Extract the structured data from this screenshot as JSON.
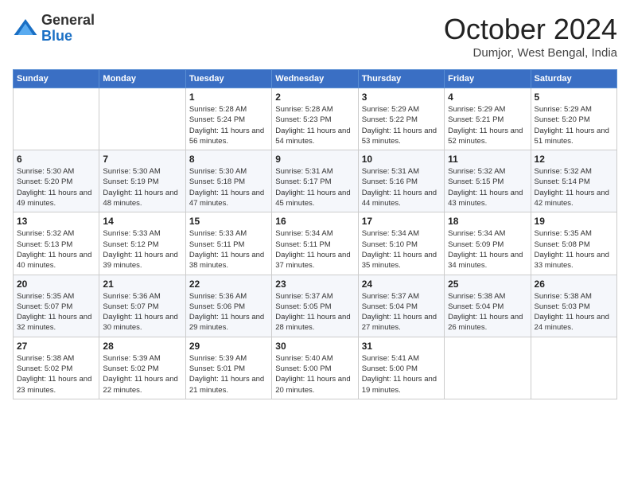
{
  "header": {
    "logo_general": "General",
    "logo_blue": "Blue",
    "month": "October 2024",
    "location": "Dumjor, West Bengal, India"
  },
  "days_of_week": [
    "Sunday",
    "Monday",
    "Tuesday",
    "Wednesday",
    "Thursday",
    "Friday",
    "Saturday"
  ],
  "weeks": [
    [
      {
        "day": "",
        "info": ""
      },
      {
        "day": "",
        "info": ""
      },
      {
        "day": "1",
        "info": "Sunrise: 5:28 AM\nSunset: 5:24 PM\nDaylight: 11 hours and 56 minutes."
      },
      {
        "day": "2",
        "info": "Sunrise: 5:28 AM\nSunset: 5:23 PM\nDaylight: 11 hours and 54 minutes."
      },
      {
        "day": "3",
        "info": "Sunrise: 5:29 AM\nSunset: 5:22 PM\nDaylight: 11 hours and 53 minutes."
      },
      {
        "day": "4",
        "info": "Sunrise: 5:29 AM\nSunset: 5:21 PM\nDaylight: 11 hours and 52 minutes."
      },
      {
        "day": "5",
        "info": "Sunrise: 5:29 AM\nSunset: 5:20 PM\nDaylight: 11 hours and 51 minutes."
      }
    ],
    [
      {
        "day": "6",
        "info": "Sunrise: 5:30 AM\nSunset: 5:20 PM\nDaylight: 11 hours and 49 minutes."
      },
      {
        "day": "7",
        "info": "Sunrise: 5:30 AM\nSunset: 5:19 PM\nDaylight: 11 hours and 48 minutes."
      },
      {
        "day": "8",
        "info": "Sunrise: 5:30 AM\nSunset: 5:18 PM\nDaylight: 11 hours and 47 minutes."
      },
      {
        "day": "9",
        "info": "Sunrise: 5:31 AM\nSunset: 5:17 PM\nDaylight: 11 hours and 45 minutes."
      },
      {
        "day": "10",
        "info": "Sunrise: 5:31 AM\nSunset: 5:16 PM\nDaylight: 11 hours and 44 minutes."
      },
      {
        "day": "11",
        "info": "Sunrise: 5:32 AM\nSunset: 5:15 PM\nDaylight: 11 hours and 43 minutes."
      },
      {
        "day": "12",
        "info": "Sunrise: 5:32 AM\nSunset: 5:14 PM\nDaylight: 11 hours and 42 minutes."
      }
    ],
    [
      {
        "day": "13",
        "info": "Sunrise: 5:32 AM\nSunset: 5:13 PM\nDaylight: 11 hours and 40 minutes."
      },
      {
        "day": "14",
        "info": "Sunrise: 5:33 AM\nSunset: 5:12 PM\nDaylight: 11 hours and 39 minutes."
      },
      {
        "day": "15",
        "info": "Sunrise: 5:33 AM\nSunset: 5:11 PM\nDaylight: 11 hours and 38 minutes."
      },
      {
        "day": "16",
        "info": "Sunrise: 5:34 AM\nSunset: 5:11 PM\nDaylight: 11 hours and 37 minutes."
      },
      {
        "day": "17",
        "info": "Sunrise: 5:34 AM\nSunset: 5:10 PM\nDaylight: 11 hours and 35 minutes."
      },
      {
        "day": "18",
        "info": "Sunrise: 5:34 AM\nSunset: 5:09 PM\nDaylight: 11 hours and 34 minutes."
      },
      {
        "day": "19",
        "info": "Sunrise: 5:35 AM\nSunset: 5:08 PM\nDaylight: 11 hours and 33 minutes."
      }
    ],
    [
      {
        "day": "20",
        "info": "Sunrise: 5:35 AM\nSunset: 5:07 PM\nDaylight: 11 hours and 32 minutes."
      },
      {
        "day": "21",
        "info": "Sunrise: 5:36 AM\nSunset: 5:07 PM\nDaylight: 11 hours and 30 minutes."
      },
      {
        "day": "22",
        "info": "Sunrise: 5:36 AM\nSunset: 5:06 PM\nDaylight: 11 hours and 29 minutes."
      },
      {
        "day": "23",
        "info": "Sunrise: 5:37 AM\nSunset: 5:05 PM\nDaylight: 11 hours and 28 minutes."
      },
      {
        "day": "24",
        "info": "Sunrise: 5:37 AM\nSunset: 5:04 PM\nDaylight: 11 hours and 27 minutes."
      },
      {
        "day": "25",
        "info": "Sunrise: 5:38 AM\nSunset: 5:04 PM\nDaylight: 11 hours and 26 minutes."
      },
      {
        "day": "26",
        "info": "Sunrise: 5:38 AM\nSunset: 5:03 PM\nDaylight: 11 hours and 24 minutes."
      }
    ],
    [
      {
        "day": "27",
        "info": "Sunrise: 5:38 AM\nSunset: 5:02 PM\nDaylight: 11 hours and 23 minutes."
      },
      {
        "day": "28",
        "info": "Sunrise: 5:39 AM\nSunset: 5:02 PM\nDaylight: 11 hours and 22 minutes."
      },
      {
        "day": "29",
        "info": "Sunrise: 5:39 AM\nSunset: 5:01 PM\nDaylight: 11 hours and 21 minutes."
      },
      {
        "day": "30",
        "info": "Sunrise: 5:40 AM\nSunset: 5:00 PM\nDaylight: 11 hours and 20 minutes."
      },
      {
        "day": "31",
        "info": "Sunrise: 5:41 AM\nSunset: 5:00 PM\nDaylight: 11 hours and 19 minutes."
      },
      {
        "day": "",
        "info": ""
      },
      {
        "day": "",
        "info": ""
      }
    ]
  ]
}
